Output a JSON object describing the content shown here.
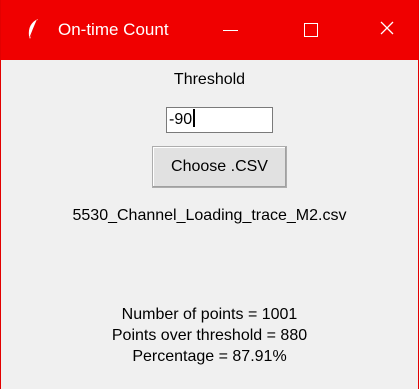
{
  "window": {
    "title": "On-time Count",
    "titlebar_color": "#f00000"
  },
  "form": {
    "threshold_label": "Threshold",
    "threshold_value": "-90",
    "choose_button_label": "Choose .CSV",
    "selected_file": "5530_Channel_Loading_trace_M2.csv"
  },
  "results": {
    "number_of_points": "Number of points = 1001",
    "points_over_threshold": "Points over threshold = 880",
    "percentage": "Percentage = 87.91%"
  },
  "icons": {
    "app": "feather-icon",
    "minimize": "minimize-icon",
    "maximize": "maximize-icon",
    "close": "close-icon"
  }
}
